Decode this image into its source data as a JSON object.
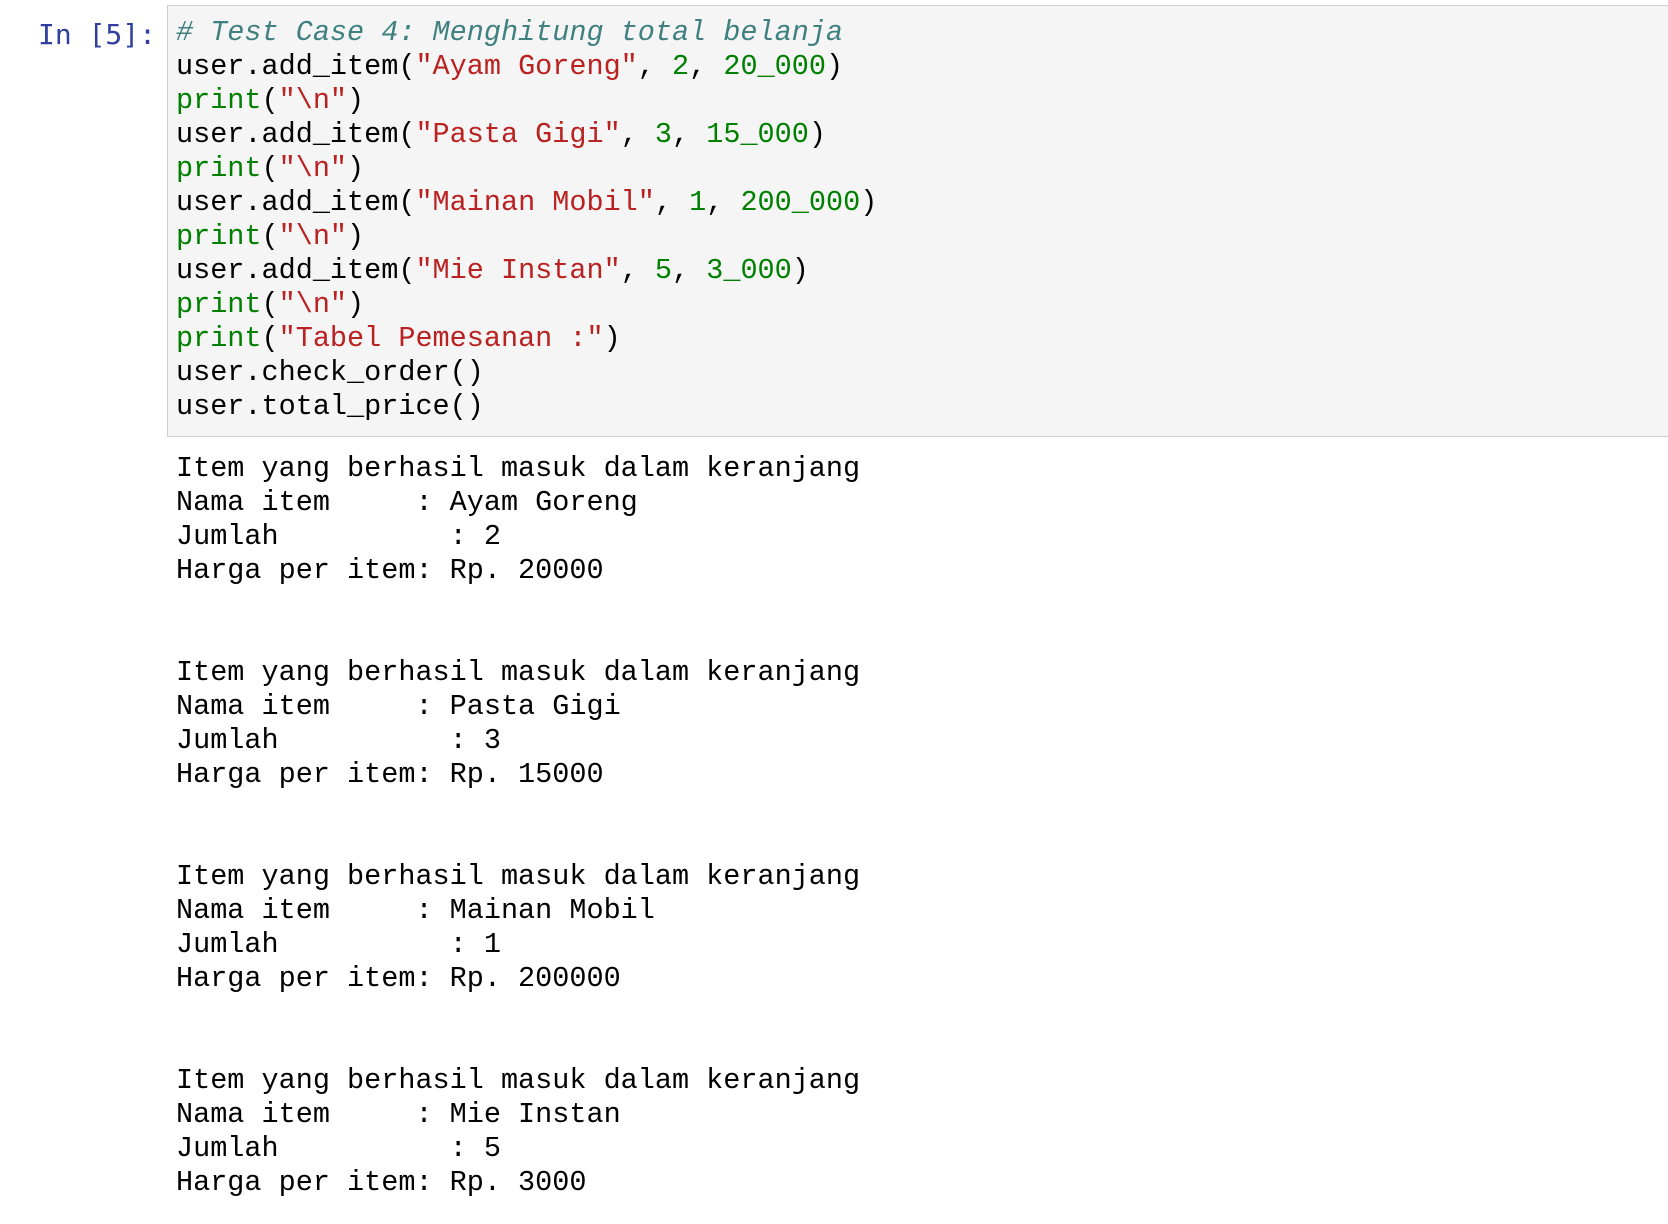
{
  "prompt": "In [5]:",
  "colors": {
    "prompt": "#303f9f",
    "comment": "#408080",
    "string": "#ba2121",
    "number": "#008000",
    "builtin": "#008000",
    "input_bg": "#f5f5f5",
    "input_border": "#cfcfcf"
  },
  "code": {
    "comment": "# Test Case 4: Menghitung total belanja",
    "lines": [
      {
        "call": "user.add_item(",
        "str": "\"Ayam Goreng\"",
        "sep1": ", ",
        "qty": "2",
        "sep2": ", ",
        "price": "20_000",
        "close": ")"
      },
      {
        "builtin": "print",
        "open": "(",
        "str": "\"\\n\"",
        "close": ")"
      },
      {
        "call": "user.add_item(",
        "str": "\"Pasta Gigi\"",
        "sep1": ", ",
        "qty": "3",
        "sep2": ", ",
        "price": "15_000",
        "close": ")"
      },
      {
        "builtin": "print",
        "open": "(",
        "str": "\"\\n\"",
        "close": ")"
      },
      {
        "call": "user.add_item(",
        "str": "\"Mainan Mobil\"",
        "sep1": ", ",
        "qty": "1",
        "sep2": ", ",
        "price": "200_000",
        "close": ")"
      },
      {
        "builtin": "print",
        "open": "(",
        "str": "\"\\n\"",
        "close": ")"
      },
      {
        "call": "user.add_item(",
        "str": "\"Mie Instan\"",
        "sep1": ", ",
        "qty": "5",
        "sep2": ", ",
        "price": "3_000",
        "close": ")"
      },
      {
        "builtin": "print",
        "open": "(",
        "str": "\"\\n\"",
        "close": ")"
      },
      {
        "builtin": "print",
        "open": "(",
        "str": "\"Tabel Pemesanan :\"",
        "close": ")"
      }
    ],
    "check_order": "user.check_order()",
    "total_price": "user.total_price()"
  },
  "output": {
    "blocks": [
      {
        "header": "Item yang berhasil masuk dalam keranjang",
        "nama": "Nama item     : Ayam Goreng",
        "jumlah": "Jumlah          : 2",
        "harga": "Harga per item: Rp. 20000"
      },
      {
        "header": "Item yang berhasil masuk dalam keranjang",
        "nama": "Nama item     : Pasta Gigi",
        "jumlah": "Jumlah          : 3",
        "harga": "Harga per item: Rp. 15000"
      },
      {
        "header": "Item yang berhasil masuk dalam keranjang",
        "nama": "Nama item     : Mainan Mobil",
        "jumlah": "Jumlah          : 1",
        "harga": "Harga per item: Rp. 200000"
      },
      {
        "header": "Item yang berhasil masuk dalam keranjang",
        "nama": "Nama item     : Mie Instan",
        "jumlah": "Jumlah          : 5",
        "harga": "Harga per item: Rp. 3000"
      }
    ]
  }
}
